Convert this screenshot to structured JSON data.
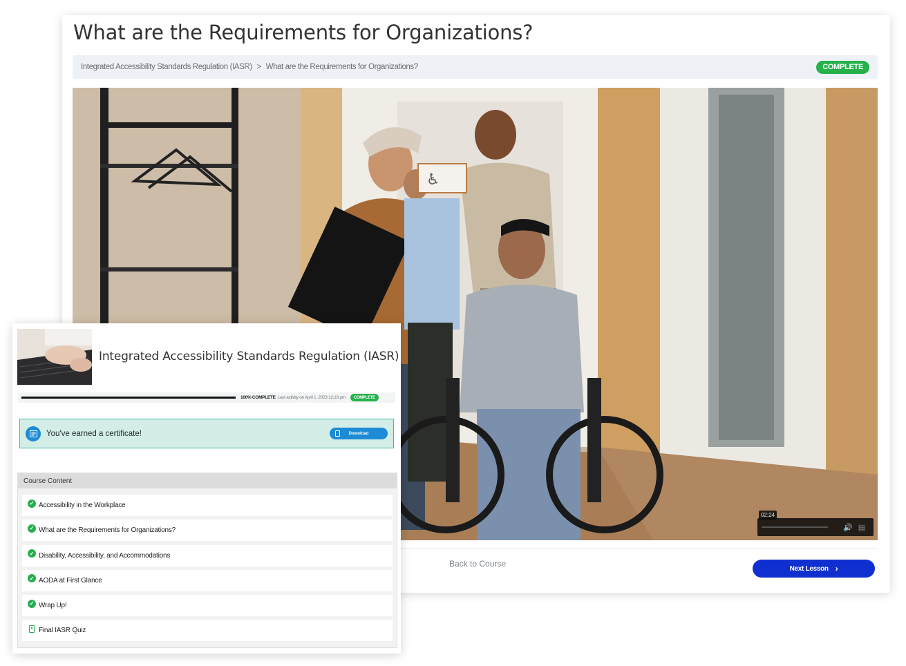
{
  "lesson": {
    "title": "What are the Requirements for Organizations?",
    "breadcrumb": {
      "course": "Integrated Accessibility Standards Regulation (IASR)",
      "separator": ">",
      "current": "What are the Requirements for Organizations?"
    },
    "status_badge": "COMPLETE",
    "video": {
      "time": "02:24",
      "progress_fraction": 0.0
    },
    "back_link": "Back to Course",
    "next_button": "Next Lesson"
  },
  "course_card": {
    "title": "Integrated Accessibility Standards Regulation (IASR)",
    "progress": {
      "percent_value": 100,
      "percent_label": "100% COMPLETE",
      "last_activity": "Last activity on April 1, 2023 12:19 pm",
      "badge": "COMPLETE"
    },
    "certificate": {
      "message": "You've earned a certificate!",
      "download_label": "Download"
    },
    "content": {
      "header": "Course Content",
      "items": [
        {
          "label": "Accessibility in the Workplace",
          "icon": "check-circle-icon",
          "completed": true
        },
        {
          "label": "What are the Requirements for Organizations?",
          "icon": "check-circle-icon",
          "completed": true
        },
        {
          "label": "Disability, Accessibility, and Accommodations",
          "icon": "check-circle-icon",
          "completed": true
        },
        {
          "label": "AODA at First Glance",
          "icon": "check-circle-icon",
          "completed": true
        },
        {
          "label": "Wrap Up!",
          "icon": "check-circle-icon",
          "completed": true
        },
        {
          "label": "Final IASR Quiz",
          "icon": "quiz-icon",
          "completed": false
        }
      ]
    }
  },
  "colors": {
    "complete_green": "#26b14b",
    "next_button_blue": "#0f2fd0",
    "certificate_bg": "#d3ede7",
    "certificate_border": "#3cbc9f",
    "download_blue": "#1d8bd6"
  }
}
